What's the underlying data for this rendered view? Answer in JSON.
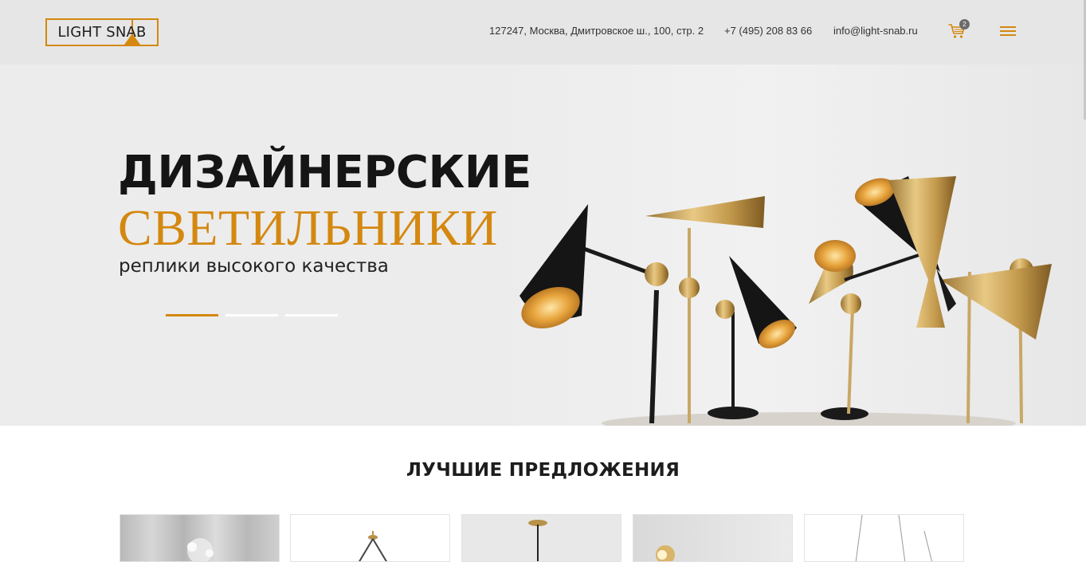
{
  "header": {
    "logo_text": "LIGHT SNAB",
    "address": "127247, Москва, Дмитровское ш., 100, стр. 2",
    "phone": "+7 (495) 208 83 66",
    "email": "info@light-snab.ru",
    "cart_count": "2",
    "cart_icon": "cart-icon",
    "menu_icon": "hamburger-icon"
  },
  "hero": {
    "title_line1": "ДИЗАЙНЕРСКИЕ",
    "title_line2": "СВЕТИЛЬНИКИ",
    "subtitle": "реплики высокого качества",
    "slides_total": 3,
    "active_slide": 1
  },
  "section": {
    "title": "ЛУЧШИЕ ПРЕДЛОЖЕНИЯ",
    "cards": [
      {
        "image": "chandelier-crystal"
      },
      {
        "image": "pendant-ring"
      },
      {
        "image": "pendant-gold"
      },
      {
        "image": "wall-lamp"
      },
      {
        "image": "pendant-wire"
      }
    ]
  },
  "colors": {
    "accent": "#d4880f",
    "header_bg": "#e6e6e6",
    "hero_bg": "#ececec",
    "text_dark": "#151515"
  }
}
